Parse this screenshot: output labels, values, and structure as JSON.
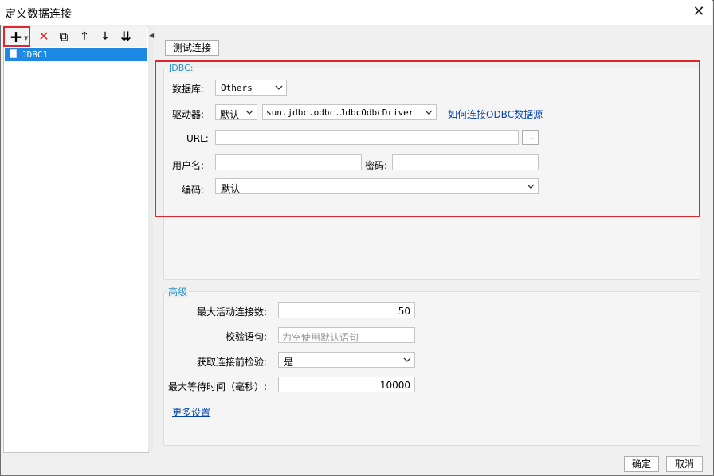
{
  "window": {
    "title": "定义数据连接",
    "close_glyph": "✕"
  },
  "toolbar": {
    "add_glyph": "+",
    "delete_glyph": "✕",
    "copy_glyph": "⧉",
    "up_glyph": "🡑",
    "down_glyph": "🡓",
    "sort_glyph": "⇊"
  },
  "tree": {
    "items": [
      {
        "label": "JDBC1"
      }
    ]
  },
  "test_button": "测试连接",
  "jdbc": {
    "legend": "JDBC:",
    "database_label": "数据库:",
    "database_value": "Others",
    "driver_label": "驱动器:",
    "driver_mode": "默认",
    "driver_class": "sun.jdbc.odbc.JdbcOdbcDriver",
    "odbc_link": "如何连接ODBC数据源",
    "url_label": "URL:",
    "url_value": "",
    "url_browse": "...",
    "user_label": "用户名:",
    "user_value": "",
    "password_label": "密码:",
    "password_value": "",
    "encoding_label": "编码:",
    "encoding_value": "默认"
  },
  "advanced": {
    "legend": "高级",
    "max_active_label": "最大活动连接数:",
    "max_active_value": "50",
    "validation_label": "校验语句:",
    "validation_placeholder": "为空使用默认语句",
    "test_before_label": "获取连接前检验:",
    "test_before_value": "是",
    "max_wait_label": "最大等待时间（毫秒）:",
    "max_wait_value": "10000",
    "more_link": "更多设置"
  },
  "footer": {
    "ok": "确定",
    "cancel": "取消"
  },
  "colors": {
    "accent": "#1e88e5",
    "highlight_red": "#e0262c",
    "link": "#0645ad",
    "legend": "#2a8fc9"
  }
}
